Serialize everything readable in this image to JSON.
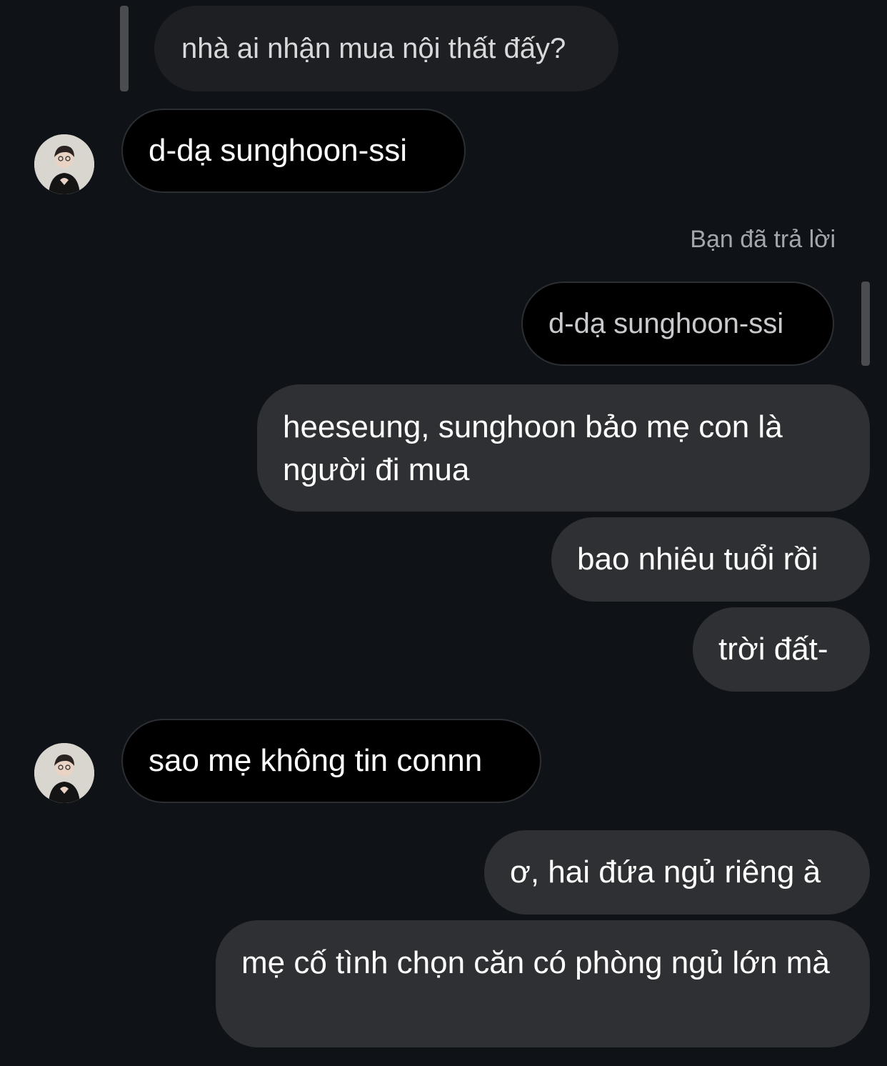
{
  "messages": [
    {
      "type": "quoted",
      "text": "nhà ai nhận mua nội thất đấy?"
    },
    {
      "type": "incoming",
      "text": "d-dạ sunghoon-ssi",
      "avatar_icon": "profile-photo"
    },
    {
      "type": "reply_label",
      "text": "Bạn đã trả lời"
    },
    {
      "type": "quoted_out",
      "text": "d-dạ sunghoon-ssi"
    },
    {
      "type": "outgoing",
      "text": "heeseung, sunghoon bảo mẹ con là người đi mua"
    },
    {
      "type": "outgoing",
      "text": "bao nhiêu tuổi rồi"
    },
    {
      "type": "outgoing",
      "text": "trời đất-"
    },
    {
      "type": "incoming",
      "text": "sao mẹ không tin connn",
      "avatar_icon": "profile-photo"
    },
    {
      "type": "outgoing",
      "text": "ơ, hai đứa ngủ riêng à"
    },
    {
      "type": "outgoing",
      "text": "mẹ cố tình chọn căn có phòng ngủ lớn mà"
    }
  ],
  "colors": {
    "background": "#0f1318",
    "outgoing_bubble": "#2f3033",
    "incoming_bubble": "#000000",
    "quoted_bubble": "#1d1f22",
    "reply_bar": "#4a4c50",
    "secondary_text": "#a3a6ab"
  }
}
